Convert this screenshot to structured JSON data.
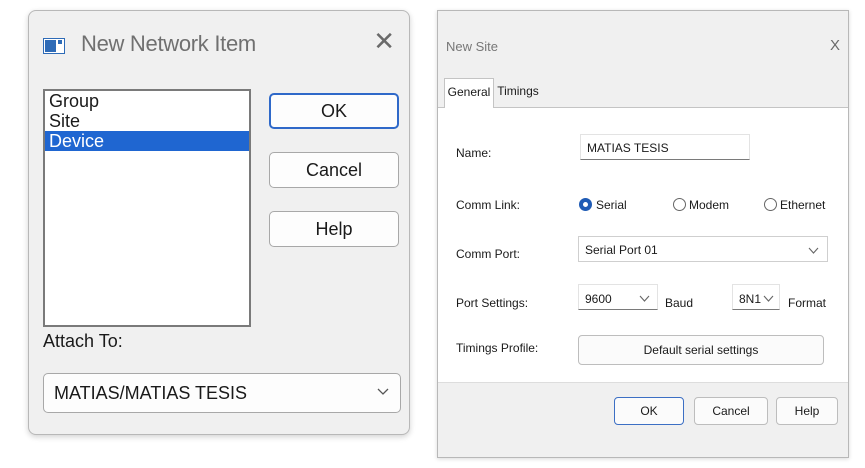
{
  "new_network_item": {
    "title": "New Network Item",
    "close_glyph": "✕",
    "icon": "window-icon",
    "types": [
      {
        "label": "Group",
        "selected": false
      },
      {
        "label": "Site",
        "selected": false
      },
      {
        "label": "Device",
        "selected": true
      }
    ],
    "buttons": {
      "ok": "OK",
      "cancel": "Cancel",
      "help": "Help"
    },
    "attach_to": {
      "label": "Attach To:",
      "value": "MATIAS/MATIAS TESIS"
    }
  },
  "new_site": {
    "title": "New Site",
    "close_glyph": "X",
    "tabs": [
      {
        "label": "General",
        "active": true
      },
      {
        "label": "Timings",
        "active": false
      }
    ],
    "name": {
      "label": "Name:",
      "value": "MATIAS TESIS"
    },
    "comm_link": {
      "label": "Comm Link:",
      "options": [
        {
          "label": "Serial",
          "selected": true
        },
        {
          "label": "Modem",
          "selected": false
        },
        {
          "label": "Ethernet",
          "selected": false
        }
      ]
    },
    "comm_port": {
      "label": "Comm Port:",
      "value": "Serial Port 01"
    },
    "port_settings": {
      "label": "Port Settings:",
      "baud_value": "9600",
      "baud_label": "Baud",
      "format_value": "8N1",
      "format_label": "Format"
    },
    "timings_profile": {
      "label": "Timings Profile:",
      "button": "Default serial settings"
    },
    "buttons": {
      "ok": "OK",
      "cancel": "Cancel",
      "help": "Help"
    }
  },
  "colors": {
    "selection": "#1f66d1",
    "default_button_border": "#2f69c9",
    "radio_selected": "#1f5bb5"
  }
}
